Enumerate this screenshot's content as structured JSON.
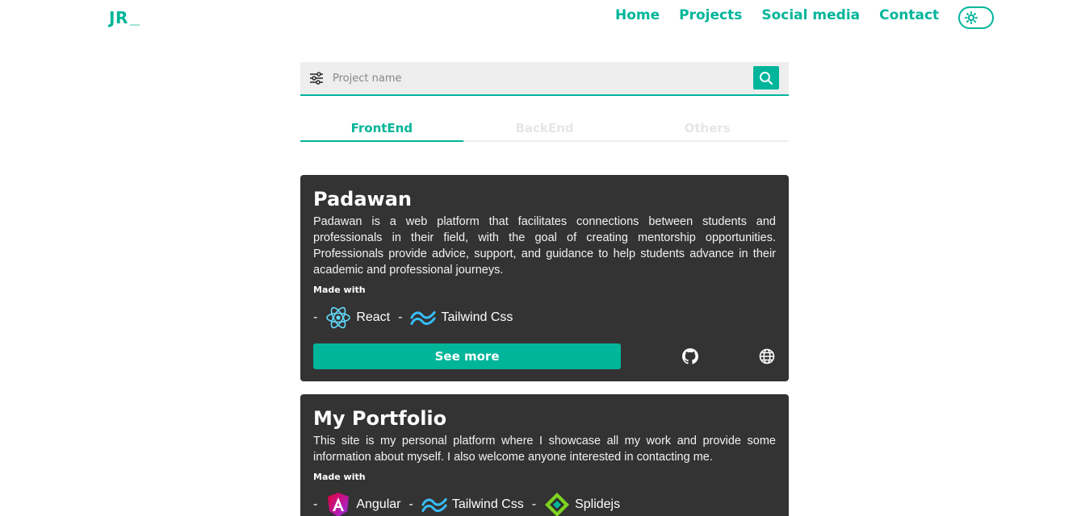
{
  "header": {
    "logo": "JR",
    "nav": [
      "Home",
      "Projects",
      "Social media",
      "Contact"
    ]
  },
  "search": {
    "placeholder": "Project name"
  },
  "tabs": [
    "FrontEnd",
    "BackEnd",
    "Others"
  ],
  "active_tab": "FrontEnd",
  "made_with_label": "Made with",
  "projects": [
    {
      "title": "Padawan",
      "description": "Padawan is a web platform that facilitates connections between students and professionals in their field, with the goal of creating mentorship opportunities. Professionals provide advice, support, and guidance to help students advance in their academic and professional journeys.",
      "techs": [
        "React",
        "Tailwind Css"
      ],
      "see_more": "See more"
    },
    {
      "title": "My Portfolio",
      "description": "This site is my personal platform where I showcase all my work and provide some information about myself. I also welcome anyone interested in contacting me.",
      "techs": [
        "Angular",
        "Tailwind Css",
        "Splidejs"
      ]
    }
  ],
  "colors": {
    "accent": "#00b59a",
    "card": "#333333",
    "search_bg": "#eeeeee"
  },
  "icons": {
    "filter": "sliders-icon",
    "search": "magnifier-icon",
    "theme": "sun-icon",
    "github": "github-icon",
    "website": "globe-icon",
    "react": "react-icon",
    "tailwind": "tailwind-icon",
    "angular": "angular-icon",
    "splidejs": "splidejs-icon"
  }
}
